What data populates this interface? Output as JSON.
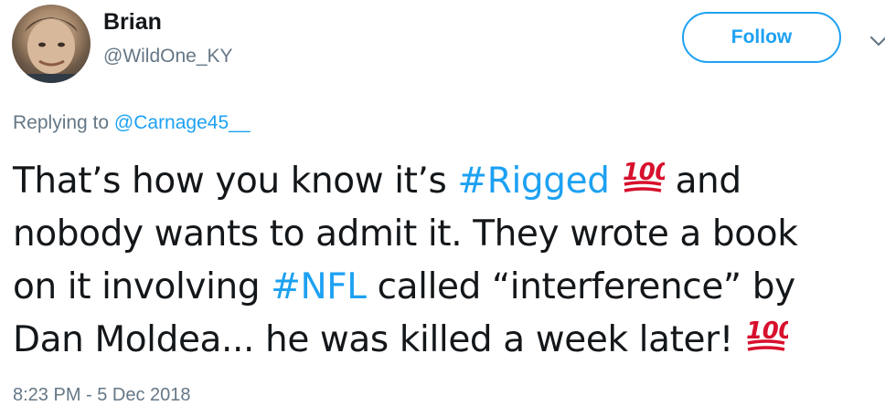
{
  "author": {
    "display_name": "Brian",
    "handle": "@WildOne_KY",
    "avatar_icon": "user-photo-avatar"
  },
  "follow_button": {
    "label": "Follow",
    "color": "#1da1f2"
  },
  "menu": {
    "icon": "chevron-down-icon"
  },
  "reply": {
    "prefix": "Replying to",
    "mention": "@Carnage45__"
  },
  "tweet": {
    "line1_a": "That’s how you know it’s",
    "hashtag_1": "#Rigged",
    "emoji_1": "💯",
    "line1_b": "and",
    "line2": "nobody wants to admit it. They wrote a book",
    "line3_a": "on it involving",
    "hashtag_2": "#NFL",
    "line3_b": "called “interference” by",
    "line4": "Dan Moldea... he was killed a week later!",
    "emoji_2": "💯"
  },
  "timestamp": "8:23 PM - 5 Dec 2018",
  "colors": {
    "link": "#1da1f2",
    "muted": "#657786",
    "text": "#14171a"
  }
}
